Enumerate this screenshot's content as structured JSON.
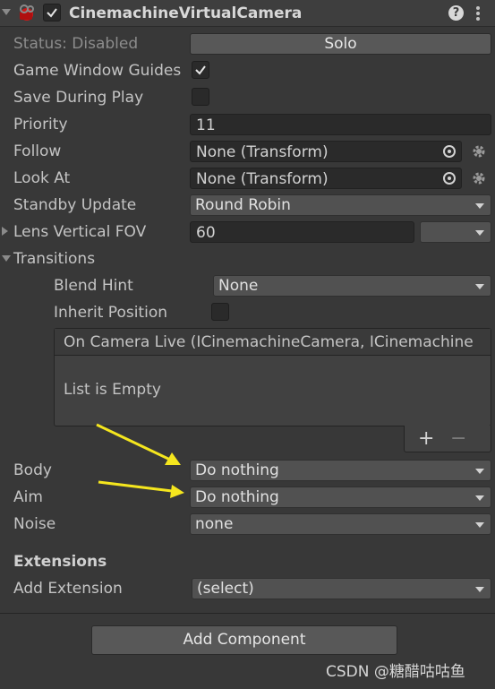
{
  "header": {
    "component_name": "CinemachineVirtualCamera",
    "enabled": true,
    "help_icon": "help-icon",
    "menu_icon": "kebab-menu-icon"
  },
  "status": {
    "label": "Status: Disabled",
    "solo_button": "Solo"
  },
  "fields": {
    "game_window_guides": {
      "label": "Game Window Guides",
      "checked": true
    },
    "save_during_play": {
      "label": "Save During Play",
      "checked": false
    },
    "priority": {
      "label": "Priority",
      "value": "11"
    },
    "follow": {
      "label": "Follow",
      "value": "None (Transform)"
    },
    "look_at": {
      "label": "Look At",
      "value": "None (Transform)"
    },
    "standby_update": {
      "label": "Standby Update",
      "value": "Round Robin"
    },
    "lens_vertical_fov": {
      "label": "Lens Vertical FOV",
      "value": "60"
    }
  },
  "transitions": {
    "label": "Transitions",
    "blend_hint": {
      "label": "Blend Hint",
      "value": "None"
    },
    "inherit_position": {
      "label": "Inherit Position",
      "checked": false
    },
    "event_list": {
      "header": "On Camera Live (ICinemachineCamera, ICinemachine",
      "empty_text": "List is Empty",
      "add": "+",
      "remove": "−"
    }
  },
  "pipeline": {
    "body": {
      "label": "Body",
      "value": "Do nothing"
    },
    "aim": {
      "label": "Aim",
      "value": "Do nothing"
    },
    "noise": {
      "label": "Noise",
      "value": "none"
    }
  },
  "extensions": {
    "title": "Extensions",
    "add_extension": {
      "label": "Add Extension",
      "value": "(select)"
    }
  },
  "add_component": "Add Component",
  "watermark": "CSDN @糖醋咕咕鱼",
  "colors": {
    "annotation_arrow": "#f5e61e",
    "background": "#383838"
  }
}
